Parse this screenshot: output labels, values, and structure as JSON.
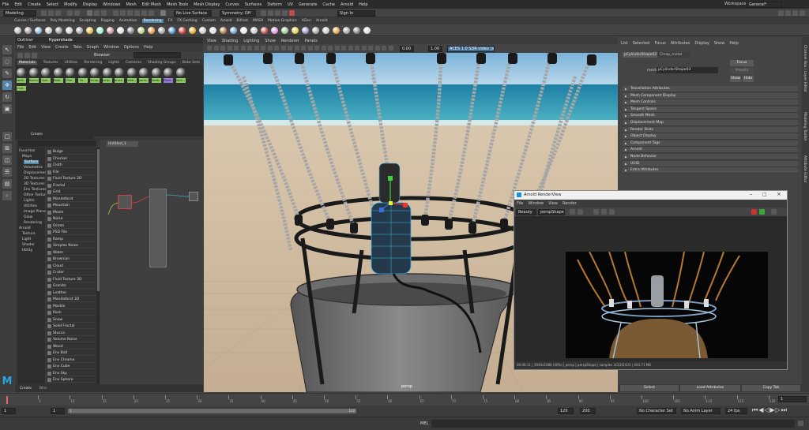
{
  "menubar": {
    "items": [
      "File",
      "Edit",
      "Create",
      "Select",
      "Modify",
      "Display",
      "Windows",
      "Mesh",
      "Edit Mesh",
      "Mesh Tools",
      "Mesh Display",
      "Curves",
      "Surfaces",
      "Deform",
      "UV",
      "Generate",
      "Cache",
      "Arnold",
      "Help"
    ],
    "workspace_label": "Workspace :",
    "workspace_value": "General*"
  },
  "statusline": {
    "mode": "Modeling",
    "live_surface": "No Live Surface",
    "symmetry": "Symmetry: Off",
    "sign_in": "Sign In"
  },
  "shelf": {
    "tabs": [
      "Curves / Surfaces",
      "Poly Modeling",
      "Sculpting",
      "Rigging",
      "Animation",
      "Rendering",
      "FX",
      "FX Caching",
      "Custom",
      "Arnold",
      "Bifrost",
      "MASH",
      "Motion Graphics",
      "XGen",
      "Arnold"
    ]
  },
  "hypershade": {
    "title": "Hypershade",
    "panel_header": "Outliner",
    "menu": [
      "File",
      "Edit",
      "View",
      "Create",
      "Tabs",
      "Graph",
      "Window",
      "Options",
      "Help"
    ],
    "browser_label": "Browser",
    "browser_tabs": [
      "Materials",
      "Textures",
      "Utilities",
      "Rendering",
      "Lights",
      "Cameras",
      "Shading Groups",
      "Bake Sets"
    ],
    "materials": [
      "lamb...",
      "Bumm...",
      "Ope...",
      "Mate...",
      "Fibe...",
      "Ilu...",
      "Scrap...",
      "scrip...",
      "brush...",
      "lamb...",
      "Jamb...",
      "Swatc...",
      "Place...",
      "Jmnt..."
    ],
    "create_label": "Create",
    "tree": [
      "Favorites",
      "Maya",
      "Surface",
      "Volumetric",
      "Displacement",
      "2D Textures",
      "3D Textures",
      "Env Textures",
      "Other Textures",
      "Lights",
      "Utilities",
      "Image Planes",
      "Glow",
      "Rendering",
      "Arnold",
      "Texture",
      "Light",
      "Shader",
      "Utility"
    ],
    "nodes": [
      "Bulge",
      "Checker",
      "Cloth",
      "File",
      "Fluid Texture 2D",
      "Fractal",
      "Grid",
      "Mandelbrot",
      "Mountain",
      "Movie",
      "Noise",
      "Ocean",
      "PSD File",
      "Ramp",
      "Simplex Noise",
      "Water",
      "Brownian",
      "Cloud",
      "Crater",
      "Fluid Texture 3D",
      "Granite",
      "Leather",
      "Mandelbrot 3D",
      "Marble",
      "Rock",
      "Snow",
      "Solid Fractal",
      "Stucco",
      "Volume Noise",
      "Wood",
      "Env Ball",
      "Env Chrome",
      "Env Cube",
      "Env Sky",
      "Env Sphere"
    ],
    "graph_tab": "Untitled_1",
    "bottom_tabs": [
      "Create",
      "Bins"
    ]
  },
  "viewport": {
    "menu": [
      "View",
      "Shading",
      "Lighting",
      "Show",
      "Renderer",
      "Panels"
    ],
    "fields": {
      "near": "0.00",
      "far": "1.00",
      "color": "ACES 1.0 SDR-video (sRGB)"
    },
    "camera_label": "persp"
  },
  "attribute_editor": {
    "menu": [
      "List",
      "Selected",
      "Focus",
      "Attributes",
      "Display",
      "Show",
      "Help"
    ],
    "tabs": [
      "pCylinderShape02",
      "Cmap_metal"
    ],
    "shape_label": "mesh:",
    "shape_value": "pCylinderShape03",
    "buttons": {
      "focus": "Focus",
      "presets": "Presets",
      "show": "Show",
      "hide": "Hide"
    },
    "sections": [
      "Tessellation Attributes",
      "Mesh Component Display",
      "Mesh Controls",
      "Tangent Space",
      "Smooth Mesh",
      "Displacement Map",
      "Render Stats",
      "Object Display",
      "Component Tags",
      "Arnold",
      "Node Behavior",
      "UUID",
      "Extra Attributes"
    ],
    "bottom_buttons": [
      "Select",
      "Load Attributes",
      "Copy Tab"
    ]
  },
  "right_strip": [
    "Channel Box / Layer Editor",
    "Modeling Toolkit",
    "Attribute Editor"
  ],
  "renderview": {
    "title": "Arnold RenderView",
    "menu": [
      "File",
      "Window",
      "View",
      "Render"
    ],
    "renderer": "Beauty",
    "camera": "perspShape",
    "status": "00:00:11 | 1920x1080 (40%) | persp | perspShape | samples 3/2/2/2/2/2 | 403.71 MB"
  },
  "timeline": {
    "ticks": [
      "5",
      "10",
      "15",
      "20",
      "25",
      "30",
      "35",
      "40",
      "45",
      "50",
      "55",
      "60",
      "65",
      "70",
      "75",
      "80",
      "85",
      "90",
      "95",
      "100",
      "105",
      "110",
      "115",
      "120"
    ],
    "current_frame": "1",
    "range_start": "1",
    "range_inner_start": "1",
    "range_inner_end": "120",
    "range_end": "120",
    "range_end2": "200",
    "character_set": "No Character Set",
    "anim_layer": "No Anim Layer",
    "fps": "24 fps"
  },
  "command_line": {
    "label": "MEL"
  },
  "colors": {
    "accent": "#5285a6",
    "material_label": "#8ccc5c",
    "selected_tab": "#5a86b0"
  }
}
